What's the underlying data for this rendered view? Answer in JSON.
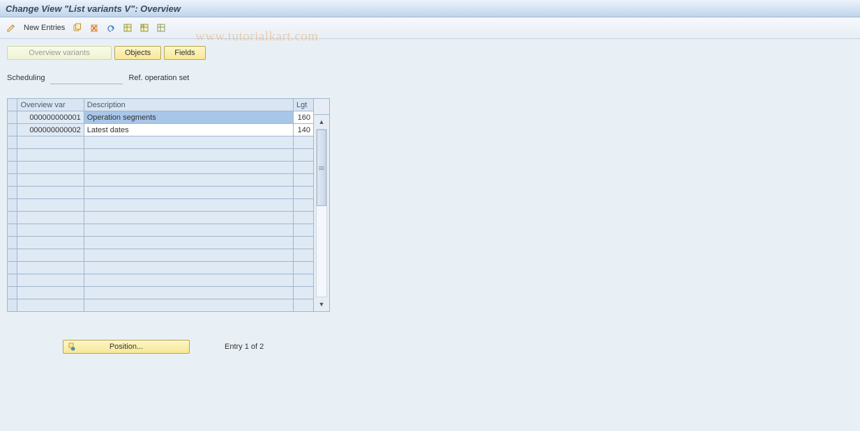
{
  "title": "Change View \"List variants                 V\": Overview",
  "toolbar": {
    "new_entries": "New Entries"
  },
  "watermark": "www.tutorialkart.com",
  "tabs": {
    "overview_variants": "Overview variants",
    "objects": "Objects",
    "fields": "Fields"
  },
  "info": {
    "scheduling_label": "Scheduling",
    "scheduling_value": "",
    "ref_op_set": "Ref. operation set"
  },
  "grid": {
    "headers": {
      "overview_var": "Overview var",
      "description": "Description",
      "lgt": "Lgt"
    },
    "rows": [
      {
        "ov": "000000000001",
        "desc": "Operation segments",
        "lgt": "160",
        "selected": true
      },
      {
        "ov": "000000000002",
        "desc": "Latest dates",
        "lgt": "140",
        "selected": false
      }
    ],
    "empty_rows": 14
  },
  "footer": {
    "position_label": "Position...",
    "entry_text": "Entry 1 of 2"
  }
}
